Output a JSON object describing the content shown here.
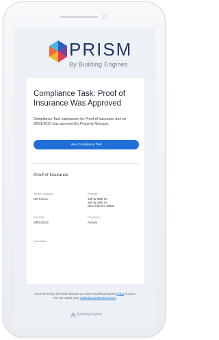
{
  "brand": {
    "name": "PRISM",
    "byline": "By Building Engines"
  },
  "email": {
    "title": "Compliance Task: Proof of Insurance Was Approved",
    "description": "Compliance Task submission for Proof of Insurance due on 08/01/2022 was approved by Property Manager.",
    "cta_label": "View Compliance Task",
    "section_title": "Proof of Insurance",
    "fields": {
      "tenant_company_label": "Tenant Company",
      "tenant_company_value": "NG Comm.",
      "property_label": "Property",
      "property_line1": "100 W 28th St",
      "property_line2": "100 W 28th St",
      "property_line3": "New York NY 10001",
      "due_date_label": "Due Date",
      "due_date_value": "08/01/2022",
      "frequency_label": "Frequency",
      "frequency_value": "Annual",
      "description_label": "Description",
      "description_value": "-"
    }
  },
  "footer": {
    "note_part1": "You're receiving this email because you have a Building Engines ",
    "note_link1": "Prism",
    "note_part2": " account.",
    "note_part3": "You can update your ",
    "note_link2": "notification preferences here",
    "note_part4": ".",
    "brand": "BuildingEngines"
  },
  "colors": {
    "brand_navy": "#1f3560",
    "cta_blue": "#1f6fd6",
    "background": "#edf1f5"
  }
}
